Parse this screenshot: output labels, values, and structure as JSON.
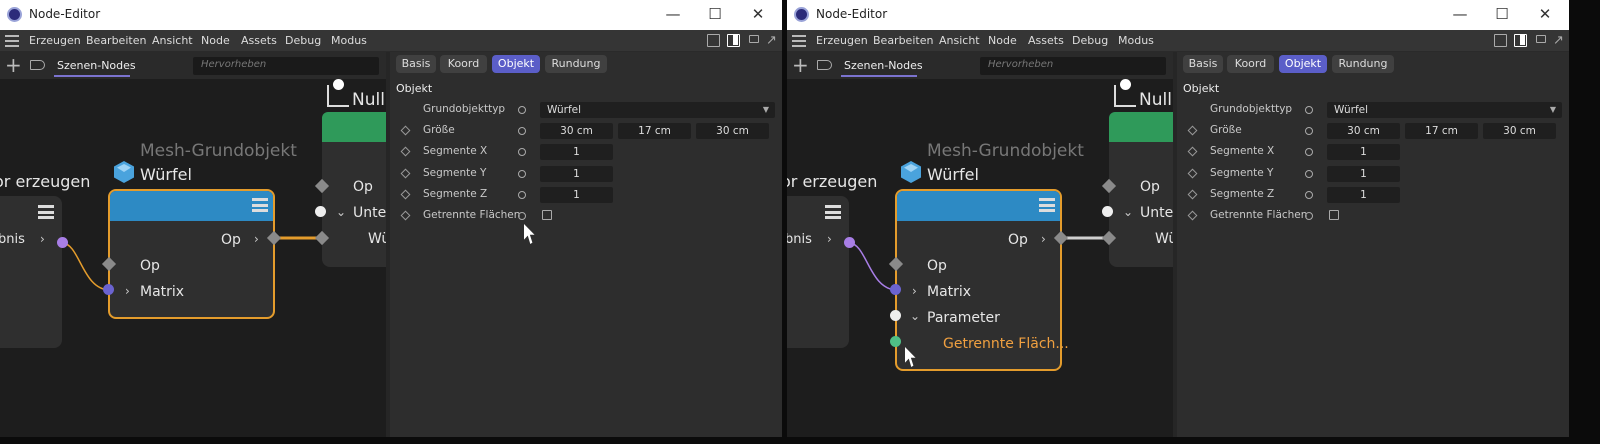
{
  "windows": [
    {
      "title": "Node-Editor",
      "menu": [
        "Erzeugen",
        "Bearbeiten",
        "Ansicht",
        "Node",
        "Assets",
        "Debug",
        "Modus"
      ],
      "scene_tab": "Szenen-Nodes",
      "search_placeholder": "Hervorheben",
      "nodes": {
        "left_title": "or erzeugen",
        "left_port": "ebnis",
        "mesh_caption": "Mesh-Grundobjekt",
        "mesh_title": "Würfel",
        "op_out": "Op",
        "op_in": "Op",
        "matrix": "Matrix",
        "null_title": "Null",
        "null_op": "Op",
        "null_unter": "Unter",
        "null_wu": "Wü"
      },
      "tabs": [
        "Basis",
        "Koord",
        "Objekt",
        "Rundung"
      ],
      "group": "Objekt",
      "rows": [
        {
          "label": "Grundobjekttyp",
          "value": "Würfel"
        },
        {
          "label": "Größe",
          "values": [
            "30 cm",
            "17 cm",
            "30 cm"
          ]
        },
        {
          "label": "Segmente X",
          "value": "1"
        },
        {
          "label": "Segmente Y",
          "value": "1"
        },
        {
          "label": "Segmente Z",
          "value": "1"
        },
        {
          "label": "Getrennte Flächen",
          "value": ""
        }
      ]
    },
    {
      "title": "Node-Editor",
      "menu": [
        "Erzeugen",
        "Bearbeiten",
        "Ansicht",
        "Node",
        "Assets",
        "Debug",
        "Modus"
      ],
      "scene_tab": "Szenen-Nodes",
      "search_placeholder": "Hervorheben",
      "nodes": {
        "left_title": "or erzeugen",
        "left_port": "ebnis",
        "mesh_caption": "Mesh-Grundobjekt",
        "mesh_title": "Würfel",
        "op_out": "Op",
        "op_in": "Op",
        "matrix": "Matrix",
        "parameter": "Parameter",
        "getrennte": "Getrennte Fläch...",
        "null_title": "Null",
        "null_op": "Op",
        "null_unter": "Unter",
        "null_wu": "Wü"
      },
      "tabs": [
        "Basis",
        "Koord",
        "Objekt",
        "Rundung"
      ],
      "group": "Objekt",
      "rows": [
        {
          "label": "Grundobjekttyp",
          "value": "Würfel"
        },
        {
          "label": "Größe",
          "values": [
            "30 cm",
            "17 cm",
            "30 cm"
          ]
        },
        {
          "label": "Segmente X",
          "value": "1"
        },
        {
          "label": "Segmente Y",
          "value": "1"
        },
        {
          "label": "Segmente Z",
          "value": "1"
        },
        {
          "label": "Getrennte Flächen",
          "value": ""
        }
      ]
    }
  ],
  "icons": [
    "app-icon",
    "minimize-icon",
    "maximize-icon",
    "close-icon",
    "hamburger-menu-icon",
    "layout-icon",
    "lock-icon",
    "undock-icon",
    "plus-icon",
    "tag-icon",
    "cube-icon",
    "null-object-icon",
    "node-menu-icon",
    "mouse-cursor-icon"
  ],
  "colors": {
    "accent": "#5b5ec8",
    "selection": "#e49c2c",
    "mesh_header": "#2d8ac4",
    "null_header": "#2f9a5a",
    "matrix_port": "#6b63d0",
    "left_port": "#a87ee6",
    "bool_port": "#4fbf85",
    "highlight_text": "#f0a040"
  }
}
